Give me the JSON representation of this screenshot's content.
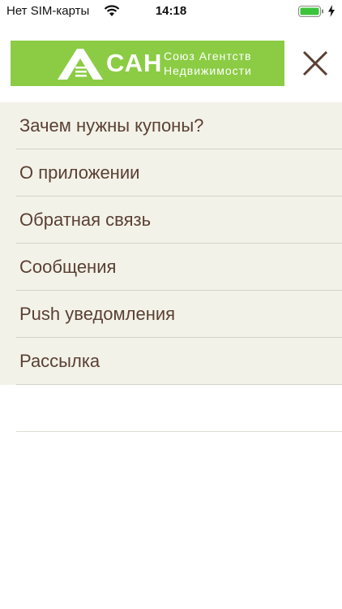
{
  "status_bar": {
    "carrier": "Нет SIM-карты",
    "time": "14:18",
    "icons": [
      "wifi-icon",
      "battery-icon",
      "charging-bolt-icon"
    ]
  },
  "header": {
    "logo": {
      "brand": "САН",
      "line1": "Союз Агентств",
      "line2": "Недвижимости",
      "color": "#8bcc44"
    },
    "close_icon": "close-icon"
  },
  "menu": {
    "background": "#f3f2e9",
    "text_color": "#5a4033",
    "items": [
      {
        "label": "Зачем нужны купоны?"
      },
      {
        "label": "О приложении"
      },
      {
        "label": "Обратная связь"
      },
      {
        "label": "Сообщения"
      },
      {
        "label": "Push уведомления"
      },
      {
        "label": "Рассылка"
      }
    ]
  }
}
